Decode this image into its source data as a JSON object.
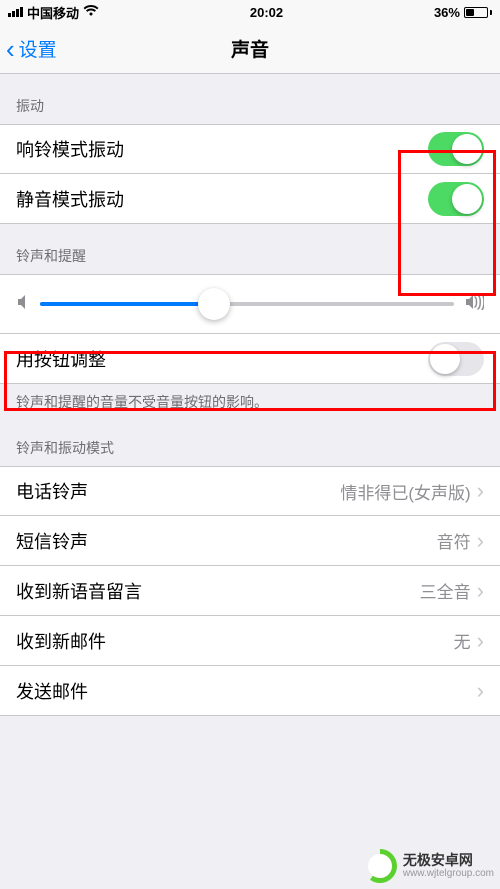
{
  "status": {
    "carrier": "中国移动",
    "time": "20:02",
    "battery": "36%"
  },
  "nav": {
    "back": "设置",
    "title": "声音"
  },
  "sections": {
    "vibration_header": "振动",
    "ringer_header": "铃声和提醒",
    "button_note": "铃声和提醒的音量不受音量按钮的影响。",
    "patterns_header": "铃声和振动模式"
  },
  "rows": {
    "vibrate_ring": "响铃模式振动",
    "vibrate_silent": "静音模式振动",
    "change_buttons": "用按钮调整",
    "ringtone_label": "电话铃声",
    "ringtone_value": "情非得已(女声版)",
    "text_label": "短信铃声",
    "text_value": "音符",
    "voicemail_label": "收到新语音留言",
    "voicemail_value": "三全音",
    "mail_label": "收到新邮件",
    "mail_value": "无",
    "sendmail_label": "发送邮件"
  },
  "switches": {
    "vibrate_ring_on": true,
    "vibrate_silent_on": true,
    "change_buttons_on": false
  },
  "slider": {
    "value_percent": 42
  },
  "watermark": {
    "title": "无极安卓网",
    "sub": "www.wjtelgroup.com"
  }
}
